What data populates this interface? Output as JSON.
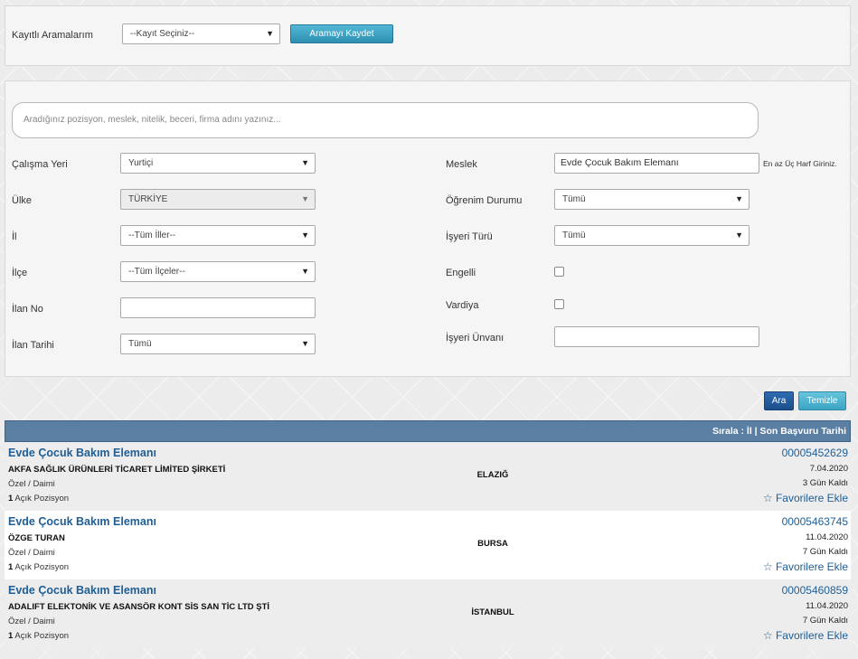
{
  "saved": {
    "label": "Kayıtlı Aramalarım",
    "select_value": "--Kayıt Seçiniz--",
    "save_button": "Aramayı Kaydet"
  },
  "search": {
    "placeholder": "Aradığınız pozisyon, meslek, nitelik, beceri, firma adını yazınız..."
  },
  "filters": {
    "work_place": {
      "label": "Çalışma Yeri",
      "value": "Yurtiçi"
    },
    "country": {
      "label": "Ülke",
      "value": "TÜRKİYE"
    },
    "province": {
      "label": "İl",
      "value": "--Tüm İller--"
    },
    "district": {
      "label": "İlçe",
      "value": "--Tüm İlçeler--"
    },
    "listing_no": {
      "label": "İlan No",
      "value": ""
    },
    "listing_date": {
      "label": "İlan Tarihi",
      "value": "Tümü"
    },
    "profession": {
      "label": "Meslek",
      "value": "Evde Çocuk Bakım Elemanı",
      "hint": "En az Üç Harf Giriniz."
    },
    "education": {
      "label": "Öğrenim Durumu",
      "value": "Tümü"
    },
    "employer_type": {
      "label": "İşyeri Türü",
      "value": "Tümü"
    },
    "disabled": {
      "label": "Engelli"
    },
    "shift": {
      "label": "Vardiya"
    },
    "employer_title": {
      "label": "İşyeri Ünvanı",
      "value": ""
    }
  },
  "actions": {
    "search": "Ara",
    "clear": "Temizle"
  },
  "results_header": {
    "sort_text": "Sırala : İl | Son Başvuru Tarihi"
  },
  "results": [
    {
      "title": "Evde Çocuk Bakım Elemanı",
      "company": "AKFA SAĞLIK ÜRÜNLERİ TİCARET LİMİTED ŞİRKETİ",
      "type": "Özel / Daimi",
      "count": "1",
      "positions_label": "Açık Pozisyon",
      "city": "ELAZIĞ",
      "number": "00005452629",
      "date": "7.04.2020",
      "days_left": "3 Gün Kaldı",
      "fav": "Favorilere Ekle"
    },
    {
      "title": "Evde Çocuk Bakım Elemanı",
      "company": "ÖZGE TURAN",
      "type": "Özel / Daimi",
      "count": "1",
      "positions_label": "Açık Pozisyon",
      "city": "BURSA",
      "number": "00005463745",
      "date": "11.04.2020",
      "days_left": "7 Gün Kaldı",
      "fav": "Favorilere Ekle"
    },
    {
      "title": "Evde Çocuk Bakım Elemanı",
      "company": "ADALIFT ELEKTONİK VE ASANSÖR KONT SİS SAN TİC LTD ŞTİ",
      "type": "Özel / Daimi",
      "count": "1",
      "positions_label": "Açık Pozisyon",
      "city": "İSTANBUL",
      "number": "00005460859",
      "date": "11.04.2020",
      "days_left": "7 Gün Kaldı",
      "fav": "Favorilere Ekle"
    }
  ]
}
